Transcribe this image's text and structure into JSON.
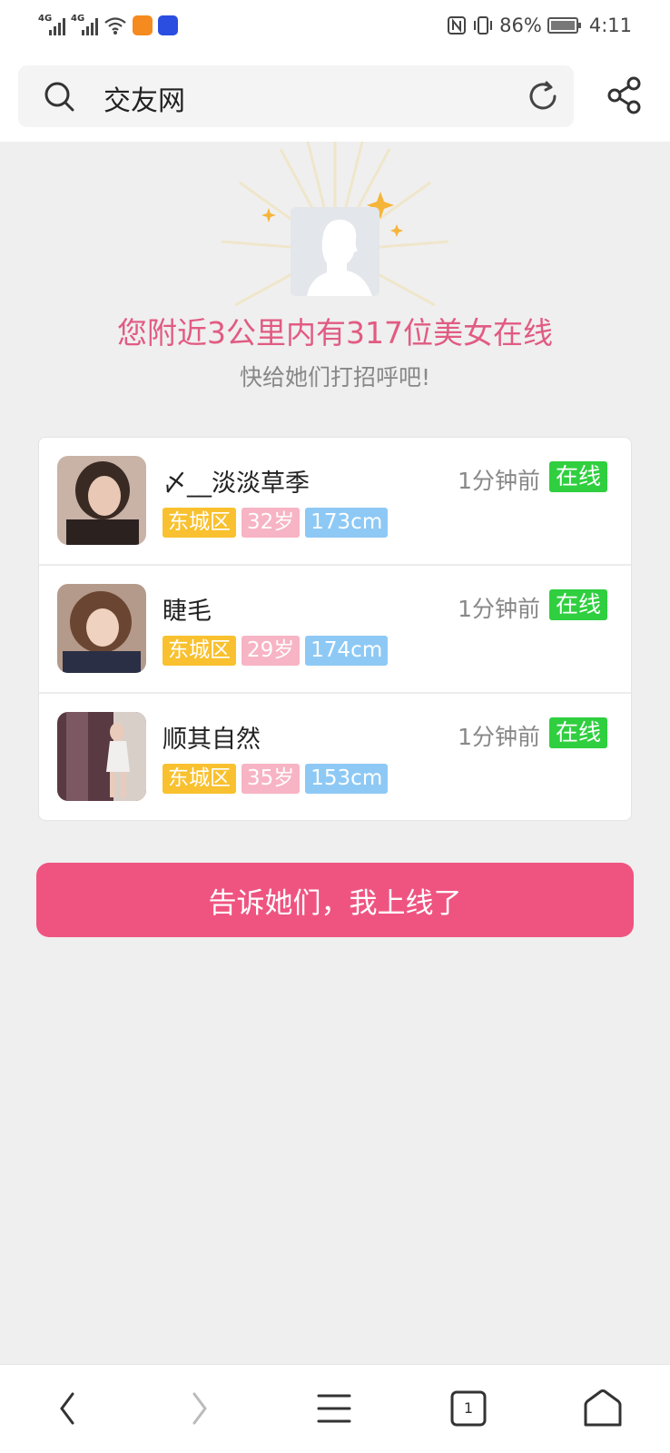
{
  "status_bar": {
    "network_1": "4G",
    "network_2": "4G",
    "battery_pct": "86%",
    "battery_level": 0.86,
    "time": "4:11"
  },
  "search": {
    "query": "交友网"
  },
  "hero": {
    "title": "您附近3公里内有317位美女在线",
    "subtitle": "快给她们打招呼吧!"
  },
  "users": [
    {
      "name": "〆__淡淡草季",
      "time": "1分钟前",
      "status": "在线",
      "area": "东城区",
      "age": "32岁",
      "height": "173cm"
    },
    {
      "name": "睫毛",
      "time": "1分钟前",
      "status": "在线",
      "area": "东城区",
      "age": "29岁",
      "height": "174cm"
    },
    {
      "name": "顺其自然",
      "time": "1分钟前",
      "status": "在线",
      "area": "东城区",
      "age": "35岁",
      "height": "153cm"
    }
  ],
  "cta_label": "告诉她们，我上线了",
  "bottom_nav": {
    "tab_count": "1"
  },
  "colors": {
    "accent_pink": "#ef5481",
    "title_pink": "#e15b82",
    "online_green": "#2fcf3f",
    "tag_area": "#f9c12f",
    "tag_age": "#f7b4c4",
    "tag_height": "#8ec9f5"
  }
}
